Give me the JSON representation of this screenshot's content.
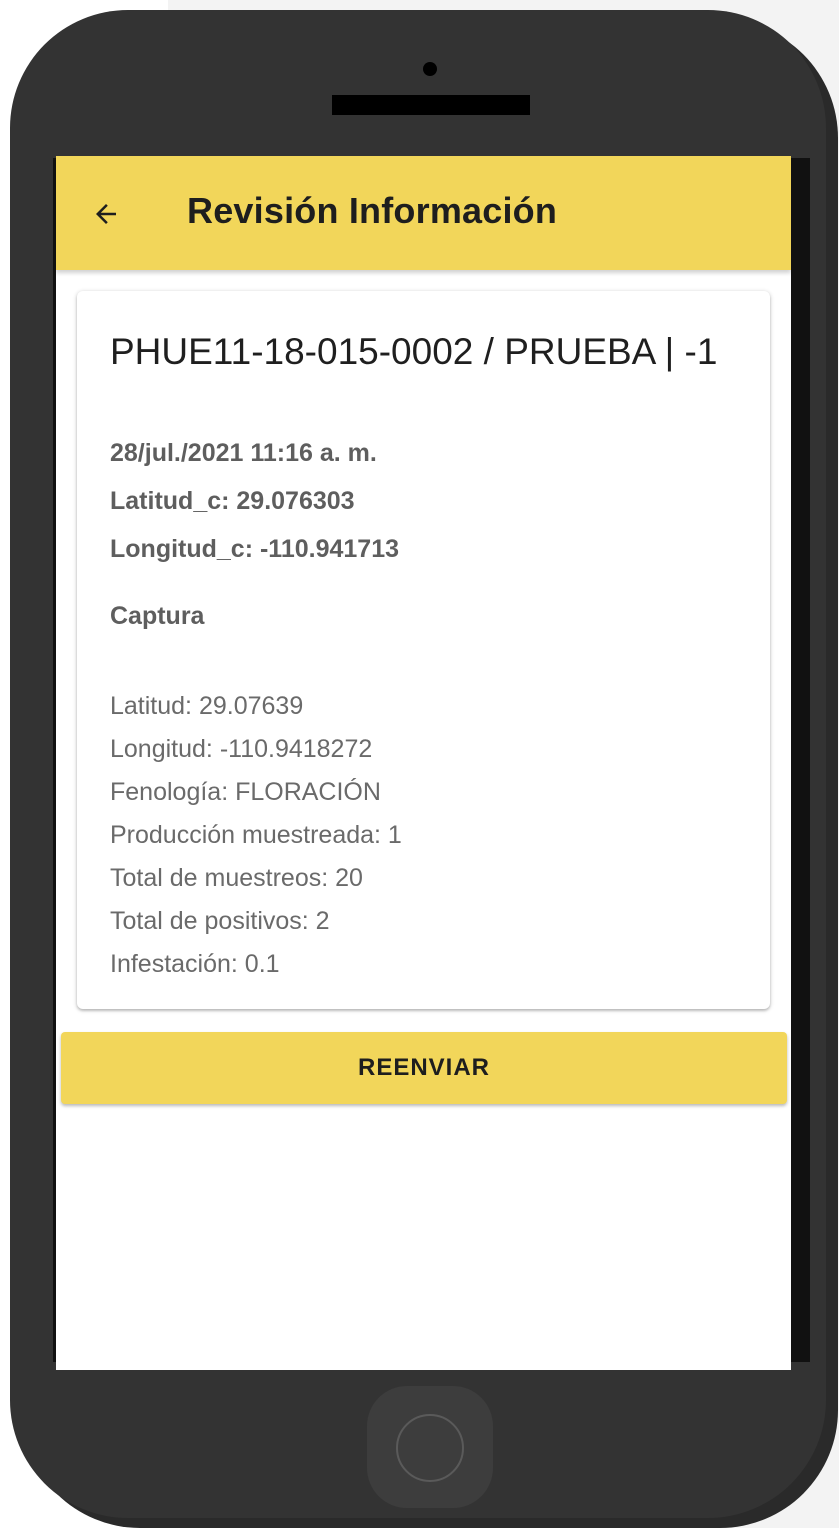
{
  "appbar": {
    "title": "Revisión Información",
    "back_icon": "arrow-left-icon"
  },
  "record": {
    "title": "PHUE11-18-015-0002 / PRUEBA | -1",
    "datetime": "28/jul./2021 11:16 a. m.",
    "latitud_c": "Latitud_c: 29.076303",
    "longitud_c": "Longitud_c: -110.941713",
    "section_label": "Captura",
    "details": [
      "Latitud: 29.07639",
      "Longitud: -110.9418272",
      "Fenología: FLORACIÓN",
      "Producción muestreada: 1",
      "Total de muestreos: 20",
      "Total de positivos: 2",
      "Infestación: 0.1"
    ]
  },
  "actions": {
    "resend_label": "REENVIAR"
  },
  "colors": {
    "accent": "#f2d65a",
    "phone_body": "#333333"
  }
}
